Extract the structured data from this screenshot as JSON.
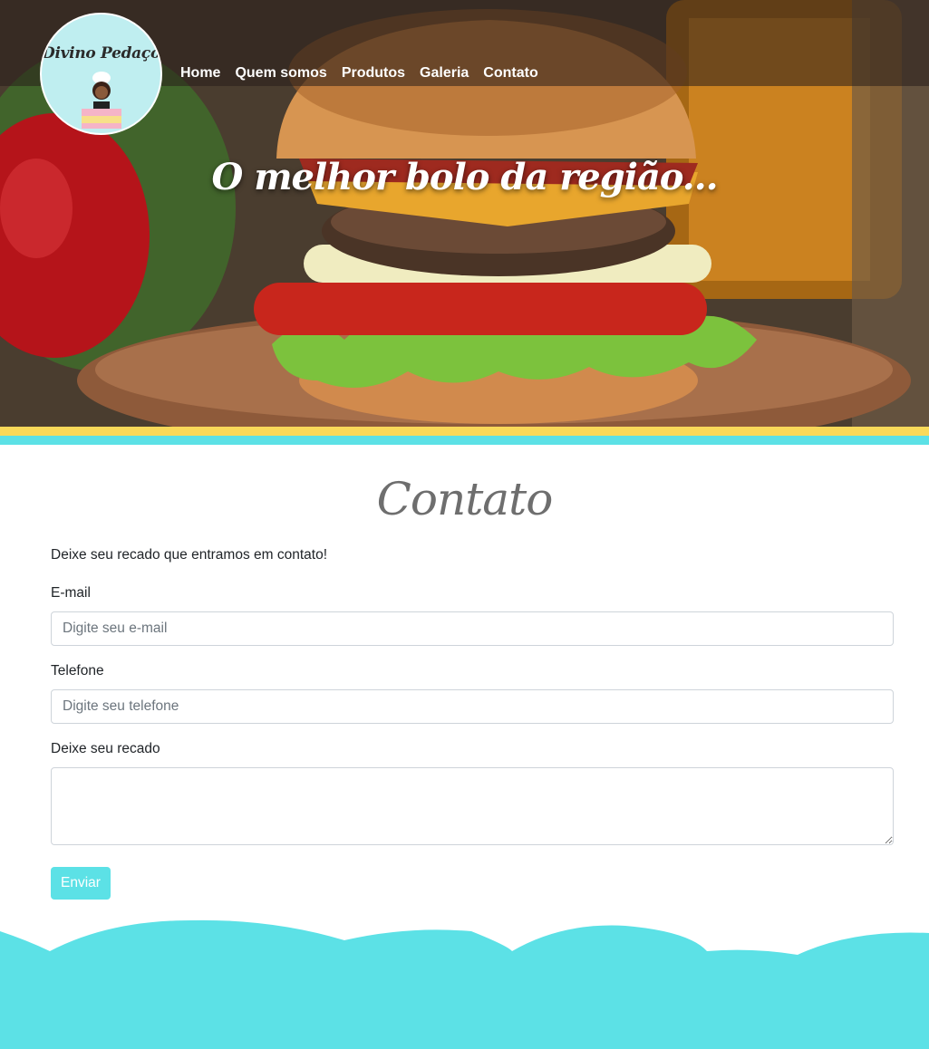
{
  "brand": {
    "logo_text": "Divino Pedaço"
  },
  "nav": {
    "items": [
      "Home",
      "Quem somos",
      "Produtos",
      "Galeria",
      "Contato"
    ]
  },
  "hero": {
    "title": "O melhor bolo da região..."
  },
  "contact": {
    "title": "Contato",
    "intro": "Deixe seu recado que entramos em contato!",
    "email": {
      "label": "E-mail",
      "placeholder": "Digite seu e-mail"
    },
    "phone": {
      "label": "Telefone",
      "placeholder": "Digite seu telefone"
    },
    "message": {
      "label": "Deixe seu recado",
      "placeholder": ""
    },
    "submit_label": "Enviar"
  },
  "colors": {
    "accent": "#5ce1e6",
    "stripe_yellow": "#f9d959",
    "title_gray": "#6e6e6e"
  }
}
